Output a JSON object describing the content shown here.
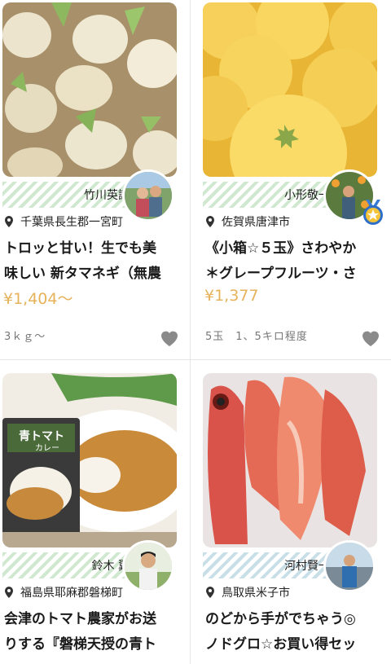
{
  "products": [
    {
      "producer": "竹川英識",
      "location": "千葉県長生郡一宮町",
      "title_line1": "トロッと甘い！生でも美",
      "title_line2": "味しい 新タマネギ（無農",
      "price": "¥1,404〜",
      "unit": "3ｋｇ〜",
      "image": "onions",
      "band_color": "#cfe8cf"
    },
    {
      "producer": "小形敬一",
      "location": "佐賀県唐津市",
      "title_line1": "《小箱☆５玉》さわやか",
      "title_line2": "＊グレープフルーツ・さ",
      "price": "¥1,377",
      "unit": "5玉　1、5キロ程度",
      "image": "grapefruit",
      "band_color": "#cfe8cf",
      "badge": "star-medal"
    },
    {
      "producer": "鈴木 翼",
      "location": "福島県耶麻郡磐梯町",
      "title_line1": "会津のトマト農家がお送",
      "title_line2": "りする『磐梯天授の青ト",
      "price": "",
      "image": "tomato-curry",
      "package_label_line1": "青トマト",
      "package_label_line2": "カレー",
      "band_color": "#cfe8cf"
    },
    {
      "producer": "河村賢一",
      "location": "鳥取県米子市",
      "title_line1": "のどから手がでちゃう◎",
      "title_line2": "ノドグロ☆お買い得セッ",
      "price": "",
      "image": "nodoguro-fish",
      "band_color": "#c9dfe8"
    }
  ],
  "colors": {
    "price": "#e6b25a",
    "heart": "#8a8a8a",
    "divider": "#e6e6e6"
  }
}
